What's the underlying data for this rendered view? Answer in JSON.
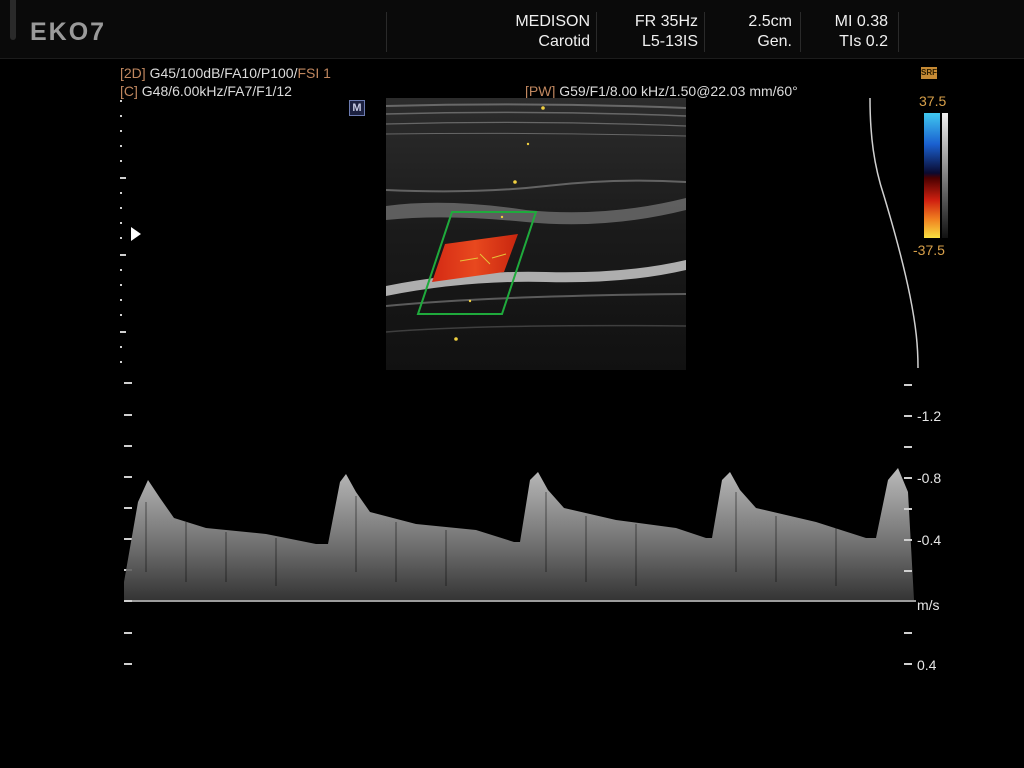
{
  "header": {
    "logo": "EKO7",
    "vendor": "MEDISON",
    "preset": "Carotid",
    "frame_rate": "FR 35Hz",
    "probe": "L5-13IS",
    "depth": "2.5cm",
    "mode": "Gen.",
    "mi": "MI 0.38",
    "tis": "TIs 0.2"
  },
  "params": {
    "twod_tag": "[2D]",
    "twod_values": " G45/100dB/FA10/P100/",
    "twod_fsi": "FSI 1",
    "color_tag": "[C]",
    "color_values": " G48/6.00kHz/FA7/F1/12",
    "pw_tag": "[PW]",
    "pw_values": " G59/F1/8.00 kHz/1.50@22.03 mm/60°"
  },
  "m_marker": "M",
  "srf_badge": "SRF",
  "colorbar": {
    "top": "37.5",
    "bottom": "-37.5"
  },
  "doppler_axis": {
    "labels": [
      "-1.2",
      "-0.8",
      "-0.4",
      "m/s",
      "0.4"
    ]
  },
  "colors": {
    "accent_orange": "#c0875f",
    "gate_green": "#1faa3c",
    "flow_red": "#e0301a"
  }
}
